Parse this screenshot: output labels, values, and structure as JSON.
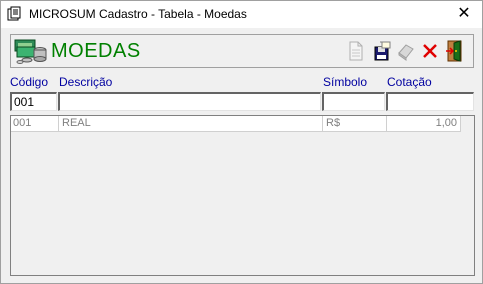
{
  "window": {
    "title": "MICROSUM Cadastro - Tabela - Moedas",
    "close_glyph": "✕"
  },
  "header": {
    "title": "MOEDAS",
    "toolbar": [
      {
        "name": "new-document-icon"
      },
      {
        "name": "save-icon"
      },
      {
        "name": "eraser-icon"
      },
      {
        "name": "delete-icon"
      },
      {
        "name": "exit-icon"
      }
    ]
  },
  "form": {
    "labels": {
      "codigo": "Código",
      "descricao": "Descrição",
      "simbolo": "Símbolo",
      "cotacao": "Cotação"
    },
    "values": {
      "codigo": "001",
      "descricao": "",
      "simbolo": "",
      "cotacao": ""
    }
  },
  "grid": {
    "rows": [
      {
        "codigo": "001",
        "descricao": "REAL",
        "simbolo": "R$",
        "cotacao": "1,00"
      }
    ]
  },
  "colors": {
    "title_green": "#008000",
    "label_blue": "#0000a0",
    "delete_red": "#e00000"
  }
}
